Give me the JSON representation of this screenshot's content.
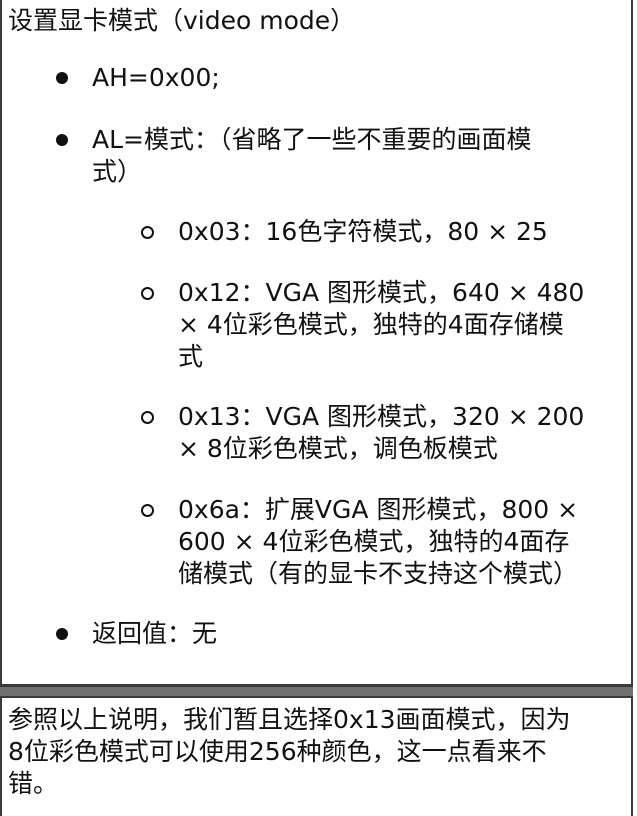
{
  "heading": "设置显卡模式（video mode）",
  "items": [
    {
      "lines": [
        "AH=0x00;"
      ]
    },
    {
      "lines": [
        "AL=模式：（省略了一些不重要的画面模",
        "式）"
      ]
    }
  ],
  "modes": [
    {
      "lines": [
        "0x03：16色字符模式，80 × 25"
      ]
    },
    {
      "lines": [
        "0x12：VGA 图形模式，640 × 480",
        "× 4位彩色模式，独特的4面存储模",
        "式"
      ]
    },
    {
      "lines": [
        "0x13：VGA 图形模式，320 × 200",
        "× 8位彩色模式，调色板模式"
      ]
    },
    {
      "lines": [
        "0x6a：扩展VGA 图形模式，800 ×",
        "600 × 4位彩色模式，独特的4面存",
        "储模式（有的显卡不支持这个模式）"
      ]
    }
  ],
  "return_value": "返回值：无",
  "paragraph": {
    "lines": [
      "参照以上说明，我们暂且选择0x13画面模式，因为",
      "8位彩色模式可以使用256种颜色，这一点看来不",
      "错。"
    ]
  }
}
